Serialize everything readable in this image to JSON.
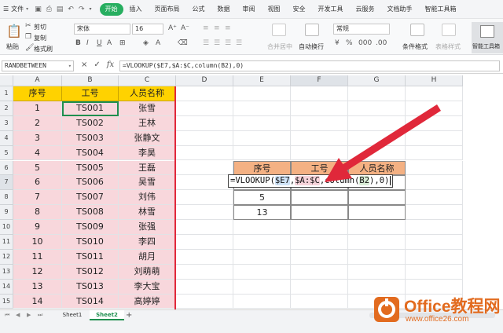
{
  "menubar": {
    "file": "文件",
    "tabs": [
      "开始",
      "插入",
      "页面布局",
      "公式",
      "数据",
      "审阅",
      "视图",
      "安全",
      "开发工具",
      "云服务",
      "文档助手",
      "智能工具箱"
    ],
    "active_tab": "开始"
  },
  "ribbon": {
    "cut": "剪切",
    "copy": "复制",
    "format_painter": "格式刷",
    "paste": "粘贴",
    "font_name": "宋体",
    "font_size": "16",
    "merge_center": "合并居中",
    "wrap_text": "自动换行",
    "number_format": "常规",
    "conditional_format": "条件格式",
    "table_style": "表格样式",
    "smart_toolbox": "智能工具箱"
  },
  "formula_bar": {
    "name_box": "RANDBETWEEN",
    "cancel_icon": "×",
    "confirm_icon": "✓",
    "fx": "fx",
    "formula": "=VLOOKUP($E7,$A:$C,column(B2),0)"
  },
  "grid": {
    "columns": [
      "A",
      "B",
      "C",
      "D",
      "E",
      "F",
      "G",
      "H"
    ],
    "rows": [
      "1",
      "2",
      "3",
      "4",
      "5",
      "6",
      "7",
      "8",
      "9",
      "10",
      "11",
      "12",
      "13",
      "14",
      "15"
    ],
    "table_headers": [
      "序号",
      "工号",
      "人员名称"
    ],
    "table_rows": [
      [
        "1",
        "TS001",
        "张雪"
      ],
      [
        "2",
        "TS002",
        "王林"
      ],
      [
        "3",
        "TS003",
        "张静文"
      ],
      [
        "4",
        "TS004",
        "李昊"
      ],
      [
        "5",
        "TS005",
        "王磊"
      ],
      [
        "6",
        "TS006",
        "吴雪"
      ],
      [
        "7",
        "TS007",
        "刘伟"
      ],
      [
        "8",
        "TS008",
        "林雪"
      ],
      [
        "9",
        "TS009",
        "张强"
      ],
      [
        "10",
        "TS010",
        "李四"
      ],
      [
        "11",
        "TS011",
        "胡月"
      ],
      [
        "12",
        "TS012",
        "刘萌萌"
      ],
      [
        "13",
        "TS013",
        "李大宝"
      ],
      [
        "14",
        "TS014",
        "高婷婷"
      ]
    ],
    "lookup_headers": [
      "序号",
      "工号",
      "人员名称"
    ],
    "lookup_values": [
      "5",
      "13"
    ],
    "formula_parts": {
      "p1": "=VLOOKUP(",
      "r1": "$E7",
      "s1": ",",
      "r2": "$A:$C",
      "s2": ",column(",
      "r3": "B2",
      "p2": "),0)"
    }
  },
  "sheets": [
    "Sheet1",
    "Sheet2"
  ],
  "active_sheet": "Sheet2",
  "watermark": {
    "brand": "Office教程网",
    "url": "www.office26.com"
  },
  "colors": {
    "accent": "#27ae60",
    "header_yellow": "#ffd200",
    "row_pink": "#f8d7dc",
    "lookup_header_orange": "#f4b183",
    "arrow_red": "#e0283a",
    "watermark_orange": "#e26b1f"
  }
}
